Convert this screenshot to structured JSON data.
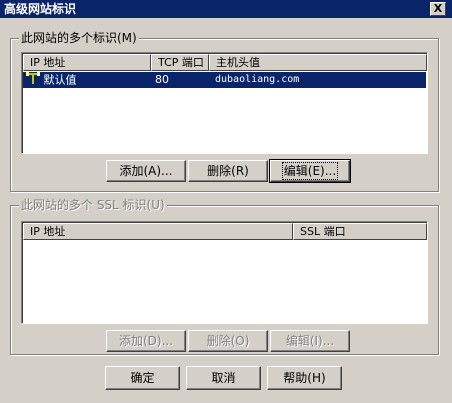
{
  "window": {
    "title": "高级网站标识",
    "close_label": "X"
  },
  "identities_group": {
    "legend": "此网站的多个标识(M)",
    "columns": [
      "IP 地址",
      "TCP 端口",
      "主机头值"
    ],
    "rows": [
      {
        "ip": "默认值",
        "port": "80",
        "host": "dubaoliang.com",
        "selected": true,
        "icon": "network-identity-icon"
      }
    ],
    "add_label": "添加(A)...",
    "remove_label": "删除(R)",
    "edit_label": "编辑(E)..."
  },
  "ssl_group": {
    "legend": "此网站的多个 SSL 标识(U)",
    "columns": [
      "IP 地址",
      "SSL 端口"
    ],
    "rows": [],
    "add_label": "添加(D)...",
    "remove_label": "删除(O)",
    "edit_label": "编辑(I)..."
  },
  "footer": {
    "ok_label": "确定",
    "cancel_label": "取消",
    "help_label": "帮助(H)"
  }
}
